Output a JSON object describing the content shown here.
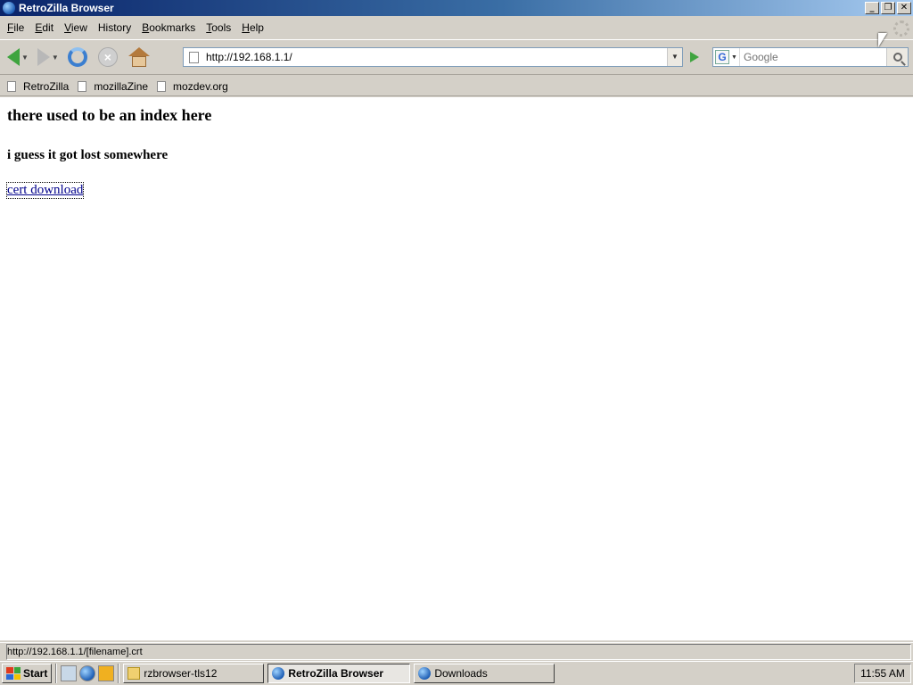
{
  "window": {
    "title": "RetroZilla Browser",
    "min_label": "_",
    "max_label": "❐",
    "close_label": "✕"
  },
  "menu": [
    {
      "acc": "F",
      "rest": "ile"
    },
    {
      "acc": "E",
      "rest": "dit"
    },
    {
      "acc": "V",
      "rest": "iew"
    },
    {
      "acc": "",
      "rest": "History"
    },
    {
      "acc": "B",
      "rest": "ookmarks"
    },
    {
      "acc": "T",
      "rest": "ools"
    },
    {
      "acc": "H",
      "rest": "elp"
    }
  ],
  "toolbar": {
    "url": "http://192.168.1.1/",
    "search_placeholder": "Google",
    "search_engine_letter": "G"
  },
  "bookmarks": [
    "RetroZilla",
    "mozillaZine",
    "mozdev.org"
  ],
  "page": {
    "heading": "there used to be an index here",
    "subheading": "i guess it got lost somewhere",
    "link": "cert download"
  },
  "status": {
    "text": "http://192.168.1.1/[filename].crt"
  },
  "taskbar": {
    "start": "Start",
    "tasks": [
      "rzbrowser-tls12",
      "RetroZilla Browser",
      "Downloads"
    ],
    "clock": "11:55 AM"
  },
  "colors": {
    "titlebar_start": "#0a246a",
    "titlebar_end": "#a6caf0",
    "link": "#00008b",
    "go_green": "#3fa43f"
  }
}
